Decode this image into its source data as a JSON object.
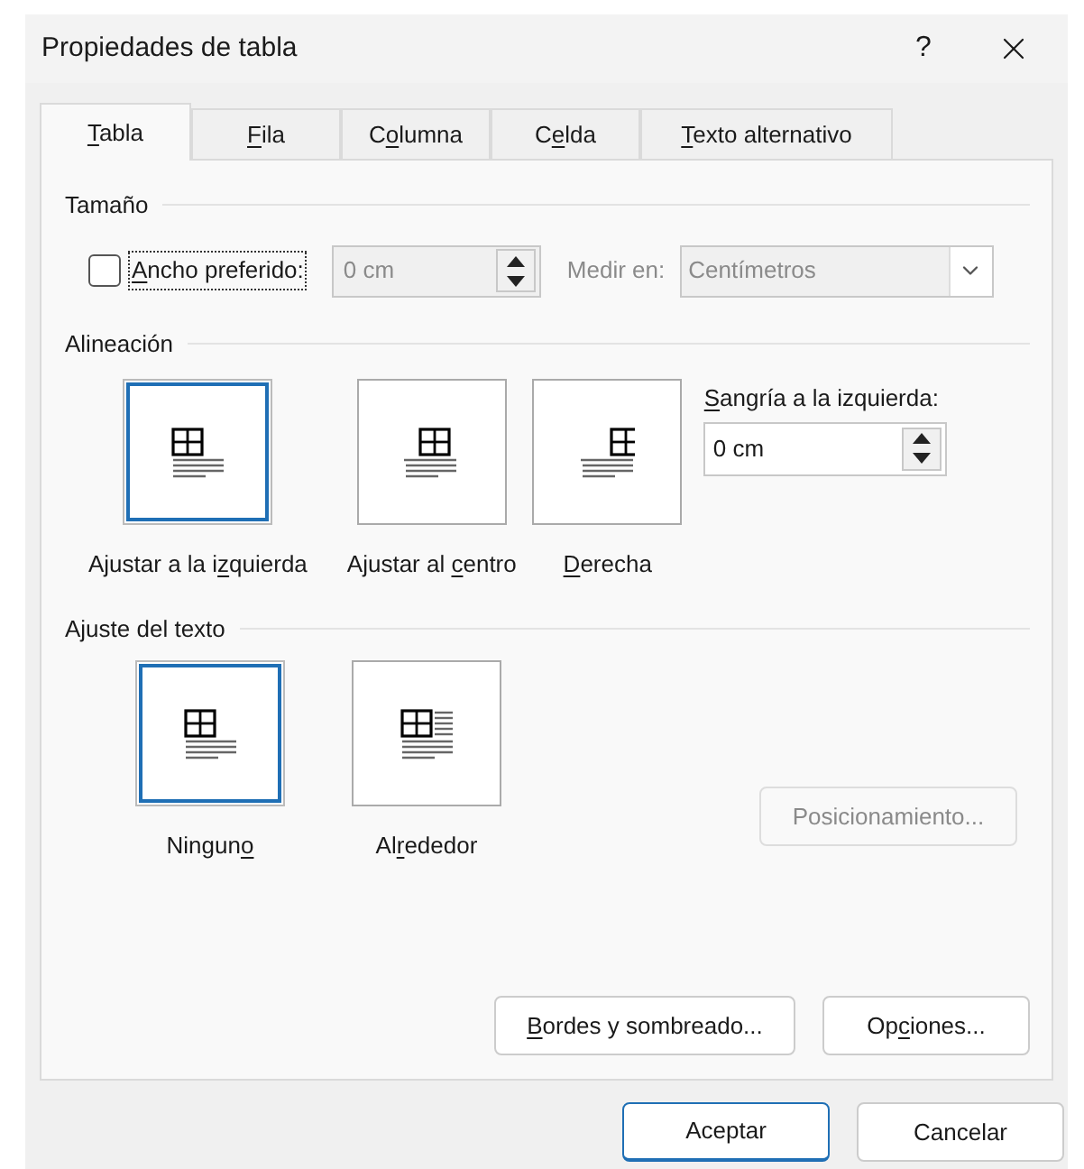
{
  "window": {
    "title": "Propiedades de tabla",
    "help": "?"
  },
  "tabs": [
    {
      "label": {
        "key": "T",
        "post": "abla"
      },
      "selected": true
    },
    {
      "label": {
        "key": "F",
        "post": "ila"
      },
      "selected": false
    },
    {
      "label": {
        "pre": "C",
        "key": "o",
        "post": "lumna"
      },
      "selected": false
    },
    {
      "label": {
        "pre": "C",
        "key": "e",
        "post": "lda"
      },
      "selected": false
    },
    {
      "label": {
        "key": "T",
        "post": "exto alternativo"
      },
      "selected": false
    }
  ],
  "size": {
    "heading": "Tamaño",
    "checkbox": {
      "label": {
        "key": "A",
        "post": "ncho preferido:"
      },
      "checked": false,
      "focused": true
    },
    "width_field": {
      "value": "0 cm",
      "disabled": true
    },
    "unit_label": {
      "text": "Medir en:",
      "disabled": true
    },
    "unit_select": {
      "value": "Centímetros",
      "disabled": true
    }
  },
  "alignment": {
    "heading": "Alineación",
    "options": [
      {
        "kind": "left",
        "label": {
          "pre": "Ajustar a la i",
          "key": "z",
          "post": "quierda"
        },
        "selected": true
      },
      {
        "kind": "center",
        "label": {
          "pre": "Ajustar al ",
          "key": "c",
          "post": "entro"
        },
        "selected": false
      },
      {
        "kind": "right",
        "label": {
          "key": "D",
          "post": "erecha"
        },
        "selected": false
      }
    ],
    "indent": {
      "label": {
        "key": "S",
        "post": "angría a la izquierda:"
      },
      "value": "0 cm"
    }
  },
  "wrapping": {
    "heading": "Ajuste del texto",
    "options": [
      {
        "kind": "none",
        "label": {
          "pre": "Ningun",
          "key": "o"
        },
        "selected": true
      },
      {
        "kind": "around",
        "label": {
          "pre": "Al",
          "key": "r",
          "post": "ededor"
        },
        "selected": false
      }
    ],
    "positioning_button": {
      "label": "Posicionamiento...",
      "disabled": true
    }
  },
  "panel_buttons": [
    {
      "label": {
        "key": "B",
        "post": "ordes y sombreado..."
      }
    },
    {
      "label": {
        "pre": "Op",
        "key": "c",
        "post": "iones..."
      }
    }
  ],
  "dialog_buttons": [
    {
      "label": "Aceptar",
      "default": true
    },
    {
      "label": "Cancelar",
      "default": false
    }
  ]
}
